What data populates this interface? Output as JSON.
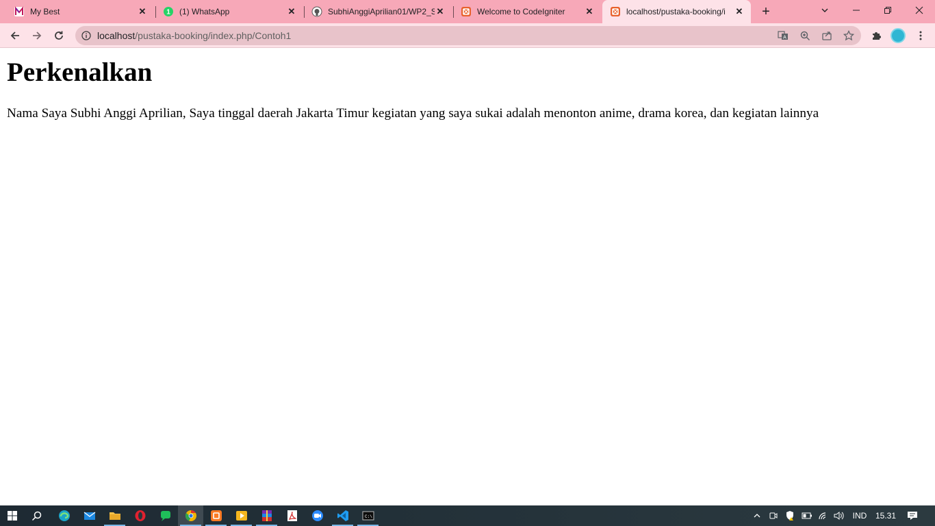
{
  "browser": {
    "tabs": [
      {
        "title": "My Best",
        "icon": "mybest-m-icon",
        "active": false
      },
      {
        "title": "(1) WhatsApp",
        "icon": "whatsapp-icon",
        "active": false
      },
      {
        "title": "SubhiAnggiAprilian01/WP2_S",
        "icon": "github-icon",
        "active": false
      },
      {
        "title": "Welcome to CodeIgniter",
        "icon": "codeigniter-icon",
        "active": false
      },
      {
        "title": "localhost/pustaka-booking/i",
        "icon": "codeigniter-icon",
        "active": true
      }
    ],
    "tab_close_glyph": "✕",
    "new_tab_glyph": "+",
    "address": {
      "host": "localhost",
      "path": "/pustaka-booking/index.php/Contoh1"
    },
    "colors": {
      "tabstrip": "#f7a8b8",
      "toolbar": "#fde2e8",
      "omnibox": "#e8c3ca"
    }
  },
  "page": {
    "heading": "Perkenalkan",
    "paragraph": "Nama Saya Subhi Anggi Aprilian, Saya tinggal daerah Jakarta Timur kegiatan yang saya sukai adalah menonton anime, drama korea, dan kegiatan lainnya"
  },
  "taskbar": {
    "apps": [
      {
        "name": "edge",
        "icon": "edge-icon"
      },
      {
        "name": "mail",
        "icon": "mail-icon"
      },
      {
        "name": "file-explorer",
        "icon": "folder-icon"
      },
      {
        "name": "opera",
        "icon": "opera-icon"
      },
      {
        "name": "chat",
        "icon": "chat-icon"
      },
      {
        "name": "chrome",
        "icon": "chrome-icon",
        "active": true
      },
      {
        "name": "xampp",
        "icon": "xampp-icon"
      },
      {
        "name": "media-player",
        "icon": "media-player-icon"
      },
      {
        "name": "winrar",
        "icon": "winrar-icon"
      },
      {
        "name": "acrobat",
        "icon": "pdf-icon"
      },
      {
        "name": "zoom",
        "icon": "zoom-icon"
      },
      {
        "name": "vscode",
        "icon": "vscode-icon"
      },
      {
        "name": "cmd",
        "icon": "terminal-icon"
      }
    ],
    "language": "IND",
    "time": "15.31"
  }
}
